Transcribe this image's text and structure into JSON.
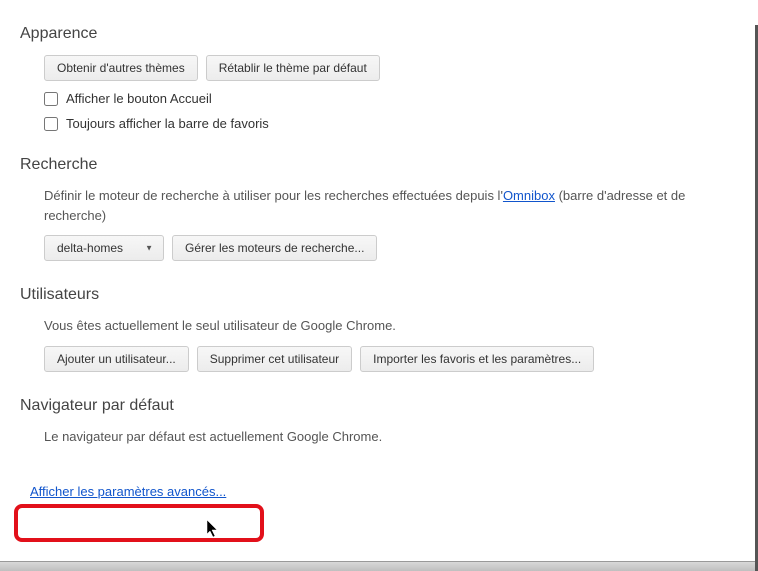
{
  "appearance": {
    "title": "Apparence",
    "get_themes_label": "Obtenir d'autres thèmes",
    "reset_theme_label": "Rétablir le thème par défaut",
    "show_home_button_label": "Afficher le bouton Accueil",
    "show_bookmarks_bar_label": "Toujours afficher la barre de favoris"
  },
  "search": {
    "title": "Recherche",
    "description_prefix": "Définir le moteur de recherche à utiliser pour les recherches effectuées depuis l'",
    "omnibox_link": "Omnibox",
    "description_suffix": " (barre d'adresse et de recherche)",
    "selected_engine": "delta-homes",
    "manage_engines_label": "Gérer les moteurs de recherche..."
  },
  "users": {
    "title": "Utilisateurs",
    "description": "Vous êtes actuellement le seul utilisateur de Google Chrome.",
    "add_user_label": "Ajouter un utilisateur...",
    "delete_user_label": "Supprimer cet utilisateur",
    "import_label": "Importer les favoris et les paramètres..."
  },
  "default_browser": {
    "title": "Navigateur par défaut",
    "description": "Le navigateur par défaut est actuellement Google Chrome."
  },
  "advanced_link": "Afficher les paramètres avancés..."
}
